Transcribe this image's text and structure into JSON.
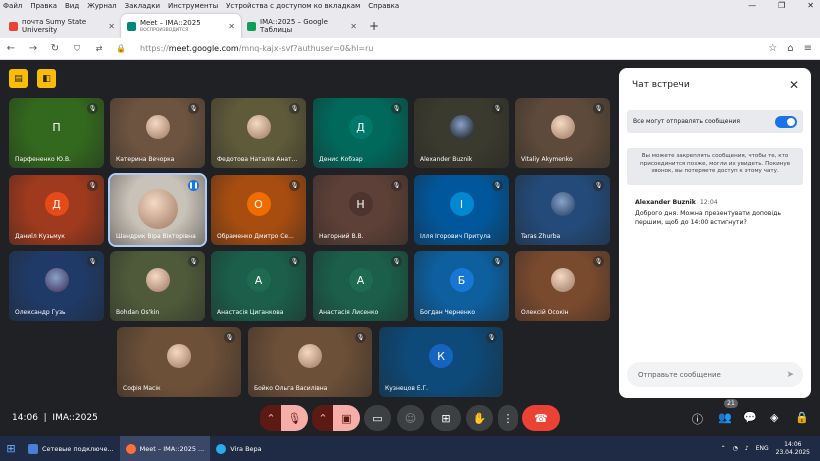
{
  "menubar": {
    "items": [
      "Файл",
      "Правка",
      "Вид",
      "Журнал",
      "Закладки",
      "Инструменты",
      "Устройства с доступом ко вкладкам",
      "Справка"
    ]
  },
  "tabs": [
    {
      "label": "почта Sumy State University",
      "icon": "gmail-icon",
      "color": "#ea4335"
    },
    {
      "label": "Meet – IMA::2025",
      "sub": "ВОСПРОИЗВОДИТСЯ",
      "icon": "meet-icon",
      "color": "#00897b"
    },
    {
      "label": "IMA::2025 – Google Таблицы",
      "icon": "sheets-icon",
      "color": "#0f9d58"
    }
  ],
  "navbar": {
    "url_prefix": "https://",
    "url_host": "meet.google.com",
    "url_path": "/mnq-kajx-svf?authuser=0&hl=ru"
  },
  "tiles": [
    {
      "name": "Парфененко Ю.В.",
      "initial": "П",
      "bg": "#33691e",
      "avbg": "#33691e",
      "photo": false
    },
    {
      "name": "Катерина Вечорка",
      "initial": "",
      "bg": "#6d5440",
      "avbg": "",
      "photo": true
    },
    {
      "name": "Федотова Наталія Анат...",
      "initial": "",
      "bg": "#5f5a3a",
      "avbg": "",
      "photo": true
    },
    {
      "name": "Денис Кобзар",
      "initial": "Д",
      "bg": "#00695c",
      "avbg": "#00796b",
      "photo": false
    },
    {
      "name": "Alexander Buznik",
      "initial": "",
      "bg": "#3a3a2e",
      "avbg": "#111",
      "photo": true
    },
    {
      "name": "Vitaliy Akymenko",
      "initial": "",
      "bg": "#5d4a3a",
      "avbg": "",
      "photo": true
    },
    {
      "name": "Даниїл Кузьмук",
      "initial": "Д",
      "bg": "#a03a1e",
      "avbg": "#e64a19",
      "photo": false
    },
    {
      "name": "Шандрик Віра Вікторівна",
      "initial": "",
      "bg": "#c9c2b8",
      "avbg": "",
      "photo": true
    },
    {
      "name": "Обраменко Дмитро Се...",
      "initial": "О",
      "bg": "#a84d10",
      "avbg": "#ef6c00",
      "photo": false
    },
    {
      "name": "Нагорний В.В.",
      "initial": "Н",
      "bg": "#5d4037",
      "avbg": "#4e342e",
      "photo": false
    },
    {
      "name": "Ілля Ігорович Притула",
      "initial": "І",
      "bg": "#01579b",
      "avbg": "#0288d1",
      "photo": false
    },
    {
      "name": "Taras Zhurba",
      "initial": "",
      "bg": "#234a78",
      "avbg": "#1e3a5f",
      "photo": true
    },
    {
      "name": "Олександр Гузь",
      "initial": "",
      "bg": "#1f3a66",
      "avbg": "#3b2a55",
      "photo": true
    },
    {
      "name": "Bohdan Os'kin",
      "initial": "",
      "bg": "#4f5a3a",
      "avbg": "",
      "photo": true
    },
    {
      "name": "Анастасія Циганкова",
      "initial": "А",
      "bg": "#1b5e4a",
      "avbg": "#1e6b52",
      "photo": false
    },
    {
      "name": "Анастасія Лисенко",
      "initial": "А",
      "bg": "#1b5e4a",
      "avbg": "#1e6b52",
      "photo": false
    },
    {
      "name": "Богдан Черненко",
      "initial": "Б",
      "bg": "#0d5f9e",
      "avbg": "#1976d2",
      "photo": false
    },
    {
      "name": "Олексій Осокін",
      "initial": "",
      "bg": "#7a4a2e",
      "avbg": "",
      "photo": true
    },
    {
      "name": "Софія Масік",
      "initial": "",
      "bg": "#6d5038",
      "avbg": "",
      "photo": true
    },
    {
      "name": "Бойко Ольга Василівна",
      "initial": "",
      "bg": "#6d5038",
      "avbg": "",
      "photo": true
    },
    {
      "name": "Кузнецов Е.Г.",
      "initial": "К",
      "bg": "#0d4a7a",
      "avbg": "#1565c0",
      "photo": false
    }
  ],
  "bottom": {
    "time": "14:06",
    "meeting": "IMA::2025",
    "participants_count": "21"
  },
  "chat": {
    "title": "Чат встречи",
    "toggle_label": "Все могут отправлять сообщения",
    "info": "Вы можете закреплять сообщения, чтобы те, кто присоединится позже, могли их увидеть. Покинув звонок, вы потеряете доступ к этому чату.",
    "msg_author": "Alexander Buznik",
    "msg_time": "12:04",
    "msg_text": "Доброго дня. Можна презентувати доповідь першим, щоб до 14:00 встигнути?",
    "input_placeholder": "Отправьте сообщение"
  },
  "taskbar": {
    "items": [
      "Сетевые подключе...",
      "Meet – IMA::2025 ...",
      "Vira Вера"
    ],
    "lang": "ENG",
    "time": "14:06",
    "date": "23.04.2025"
  }
}
